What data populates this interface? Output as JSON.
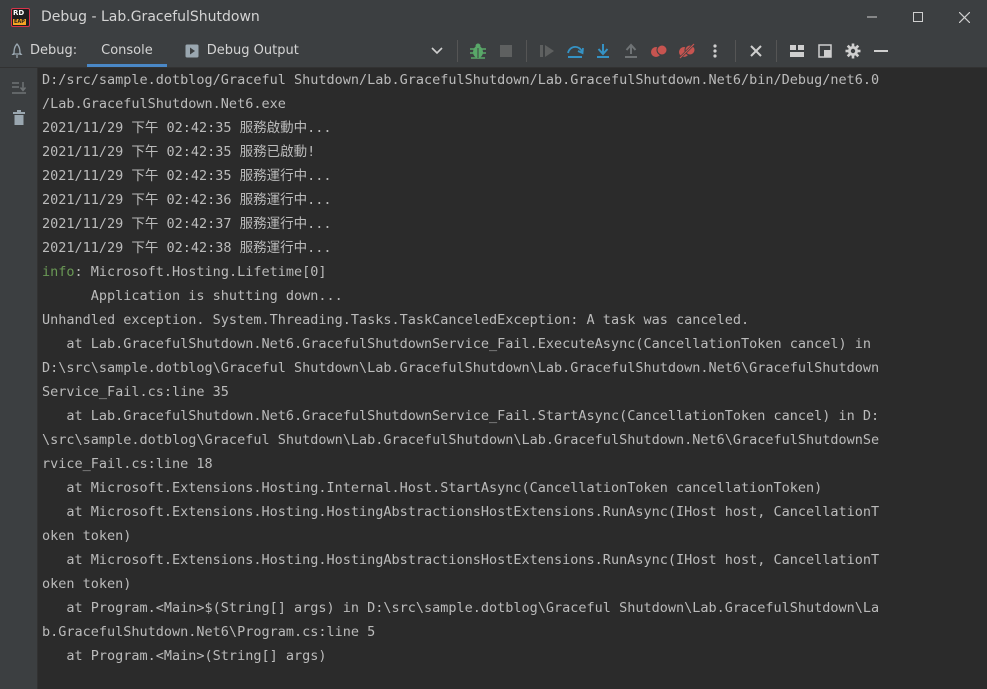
{
  "window": {
    "title": "Debug - Lab.GracefulShutdown",
    "logo_text": "RD",
    "logo_badge": "EAP"
  },
  "toolbar": {
    "debug_label": "Debug:",
    "tabs": [
      {
        "label": "Console",
        "active": true
      },
      {
        "label": "Debug Output",
        "active": false
      }
    ]
  },
  "colors": {
    "accent": "#4a88c7",
    "resume_green": "#59a869",
    "breakpoint_red": "#c75450",
    "step_blue": "#3592c4",
    "info_green": "#6a9955"
  },
  "console": {
    "lines": [
      {
        "prefix": "",
        "text": "D:/src/sample.dotblog/Graceful Shutdown/Lab.GracefulShutdown/Lab.GracefulShutdown.Net6/bin/Debug/net6.0"
      },
      {
        "prefix": "",
        "text": "/Lab.GracefulShutdown.Net6.exe"
      },
      {
        "prefix": "",
        "text": "2021/11/29 下午 02:42:35 服務啟動中..."
      },
      {
        "prefix": "",
        "text": "2021/11/29 下午 02:42:35 服務已啟動!"
      },
      {
        "prefix": "",
        "text": "2021/11/29 下午 02:42:35 服務運行中..."
      },
      {
        "prefix": "",
        "text": "2021/11/29 下午 02:42:36 服務運行中..."
      },
      {
        "prefix": "",
        "text": "2021/11/29 下午 02:42:37 服務運行中..."
      },
      {
        "prefix": "",
        "text": "2021/11/29 下午 02:42:38 服務運行中..."
      },
      {
        "prefix": "info",
        "text": ": Microsoft.Hosting.Lifetime[0]"
      },
      {
        "prefix": "",
        "text": "      Application is shutting down..."
      },
      {
        "prefix": "",
        "text": "Unhandled exception. System.Threading.Tasks.TaskCanceledException: A task was canceled."
      },
      {
        "prefix": "",
        "text": "   at Lab.GracefulShutdown.Net6.GracefulShutdownService_Fail.ExecuteAsync(CancellationToken cancel) in"
      },
      {
        "prefix": "",
        "text": "D:\\src\\sample.dotblog\\Graceful Shutdown\\Lab.GracefulShutdown\\Lab.GracefulShutdown.Net6\\GracefulShutdown"
      },
      {
        "prefix": "",
        "text": "Service_Fail.cs:line 35"
      },
      {
        "prefix": "",
        "text": "   at Lab.GracefulShutdown.Net6.GracefulShutdownService_Fail.StartAsync(CancellationToken cancel) in D:"
      },
      {
        "prefix": "",
        "text": "\\src\\sample.dotblog\\Graceful Shutdown\\Lab.GracefulShutdown\\Lab.GracefulShutdown.Net6\\GracefulShutdownSe"
      },
      {
        "prefix": "",
        "text": "rvice_Fail.cs:line 18"
      },
      {
        "prefix": "",
        "text": "   at Microsoft.Extensions.Hosting.Internal.Host.StartAsync(CancellationToken cancellationToken)"
      },
      {
        "prefix": "",
        "text": "   at Microsoft.Extensions.Hosting.HostingAbstractionsHostExtensions.RunAsync(IHost host, CancellationT"
      },
      {
        "prefix": "",
        "text": "oken token)"
      },
      {
        "prefix": "",
        "text": "   at Microsoft.Extensions.Hosting.HostingAbstractionsHostExtensions.RunAsync(IHost host, CancellationT"
      },
      {
        "prefix": "",
        "text": "oken token)"
      },
      {
        "prefix": "",
        "text": "   at Program.<Main>$(String[] args) in D:\\src\\sample.dotblog\\Graceful Shutdown\\Lab.GracefulShutdown\\La"
      },
      {
        "prefix": "",
        "text": "b.GracefulShutdown.Net6\\Program.cs:line 5"
      },
      {
        "prefix": "",
        "text": "   at Program.<Main>(String[] args)"
      }
    ]
  }
}
